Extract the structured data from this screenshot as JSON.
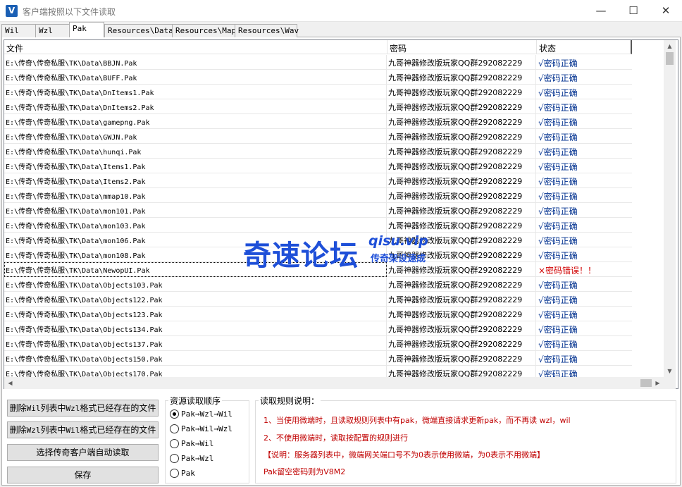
{
  "window": {
    "app_icon": "V",
    "title": "客户端按照以下文件读取",
    "minimize": "—",
    "maximize": "☐",
    "close": "✕"
  },
  "tabs": [
    {
      "label": "Wil",
      "active": false
    },
    {
      "label": "Wzl",
      "active": false
    },
    {
      "label": "Pak",
      "active": true
    },
    {
      "label": "Resources\\Data",
      "active": false
    },
    {
      "label": "Resources\\Map",
      "active": false
    },
    {
      "label": "Resources\\Wav",
      "active": false
    }
  ],
  "list": {
    "columns": [
      "文件",
      "密码",
      "状态"
    ],
    "rows": [
      {
        "file": "E:\\传奇\\传奇私服\\TK\\Data\\BBJN.Pak",
        "password": "九哥神器修改版玩家QQ群292082229",
        "status": "√密码正确",
        "ok": true
      },
      {
        "file": "E:\\传奇\\传奇私服\\TK\\Data\\BUFF.Pak",
        "password": "九哥神器修改版玩家QQ群292082229",
        "status": "√密码正确",
        "ok": true
      },
      {
        "file": "E:\\传奇\\传奇私服\\TK\\Data\\DnItems1.Pak",
        "password": "九哥神器修改版玩家QQ群292082229",
        "status": "√密码正确",
        "ok": true
      },
      {
        "file": "E:\\传奇\\传奇私服\\TK\\Data\\DnItems2.Pak",
        "password": "九哥神器修改版玩家QQ群292082229",
        "status": "√密码正确",
        "ok": true
      },
      {
        "file": "E:\\传奇\\传奇私服\\TK\\Data\\gamepng.Pak",
        "password": "九哥神器修改版玩家QQ群292082229",
        "status": "√密码正确",
        "ok": true
      },
      {
        "file": "E:\\传奇\\传奇私服\\TK\\Data\\GWJN.Pak",
        "password": "九哥神器修改版玩家QQ群292082229",
        "status": "√密码正确",
        "ok": true
      },
      {
        "file": "E:\\传奇\\传奇私服\\TK\\Data\\hunqi.Pak",
        "password": "九哥神器修改版玩家QQ群292082229",
        "status": "√密码正确",
        "ok": true
      },
      {
        "file": "E:\\传奇\\传奇私服\\TK\\Data\\Items1.Pak",
        "password": "九哥神器修改版玩家QQ群292082229",
        "status": "√密码正确",
        "ok": true
      },
      {
        "file": "E:\\传奇\\传奇私服\\TK\\Data\\Items2.Pak",
        "password": "九哥神器修改版玩家QQ群292082229",
        "status": "√密码正确",
        "ok": true
      },
      {
        "file": "E:\\传奇\\传奇私服\\TK\\Data\\mmap10.Pak",
        "password": "九哥神器修改版玩家QQ群292082229",
        "status": "√密码正确",
        "ok": true
      },
      {
        "file": "E:\\传奇\\传奇私服\\TK\\Data\\mon101.Pak",
        "password": "九哥神器修改版玩家QQ群292082229",
        "status": "√密码正确",
        "ok": true
      },
      {
        "file": "E:\\传奇\\传奇私服\\TK\\Data\\mon103.Pak",
        "password": "九哥神器修改版玩家QQ群292082229",
        "status": "√密码正确",
        "ok": true
      },
      {
        "file": "E:\\传奇\\传奇私服\\TK\\Data\\mon106.Pak",
        "password": "九哥神器修改版玩家QQ群292082229",
        "status": "√密码正确",
        "ok": true
      },
      {
        "file": "E:\\传奇\\传奇私服\\TK\\Data\\mon108.Pak",
        "password": "九哥神器修改版玩家QQ群292082229",
        "status": "√密码正确",
        "ok": true
      },
      {
        "file": "E:\\传奇\\传奇私服\\TK\\Data\\NewopUI.Pak",
        "password": "九哥神器修改版玩家QQ群292082229",
        "status": "×密码错误！！",
        "ok": false,
        "selected": true
      },
      {
        "file": "E:\\传奇\\传奇私服\\TK\\Data\\Objects103.Pak",
        "password": "九哥神器修改版玩家QQ群292082229",
        "status": "√密码正确",
        "ok": true
      },
      {
        "file": "E:\\传奇\\传奇私服\\TK\\Data\\Objects122.Pak",
        "password": "九哥神器修改版玩家QQ群292082229",
        "status": "√密码正确",
        "ok": true
      },
      {
        "file": "E:\\传奇\\传奇私服\\TK\\Data\\Objects123.Pak",
        "password": "九哥神器修改版玩家QQ群292082229",
        "status": "√密码正确",
        "ok": true
      },
      {
        "file": "E:\\传奇\\传奇私服\\TK\\Data\\Objects134.Pak",
        "password": "九哥神器修改版玩家QQ群292082229",
        "status": "√密码正确",
        "ok": true
      },
      {
        "file": "E:\\传奇\\传奇私服\\TK\\Data\\Objects137.Pak",
        "password": "九哥神器修改版玩家QQ群292082229",
        "status": "√密码正确",
        "ok": true
      },
      {
        "file": "E:\\传奇\\传奇私服\\TK\\Data\\Objects150.Pak",
        "password": "九哥神器修改版玩家QQ群292082229",
        "status": "√密码正确",
        "ok": true
      },
      {
        "file": "E:\\传奇\\传奇私服\\TK\\Data\\Objects170.Pak",
        "password": "九哥神器修改版玩家QQ群292082229",
        "status": "√密码正确",
        "ok": true
      }
    ],
    "scroll_up": "▲",
    "scroll_down": "▼",
    "scroll_left": "◀",
    "scroll_right": "▶"
  },
  "colors": {
    "ok_status": "#00308f",
    "error_status": "#d00000",
    "rules_text": "#c00000",
    "watermark": "#1e4fd8"
  },
  "buttons": {
    "delete_wil_prefix": "删除",
    "delete_wil_mono1": "Wil",
    "delete_wil_mid": "列表中",
    "delete_wil_mono2": "Wzl",
    "delete_wil_suffix": "格式已经存在的文件",
    "delete_wzl_prefix": "删除",
    "delete_wzl_mono1": "Wzl",
    "delete_wzl_mid": "列表中",
    "delete_wzl_mono2": "Wil",
    "delete_wzl_suffix": "格式已经存在的文件",
    "auto_read": "选择传奇客户端自动读取",
    "save": "保存"
  },
  "order_group": {
    "title": "资源读取顺序",
    "options": [
      {
        "label": "Pak→Wzl→Wil",
        "checked": true
      },
      {
        "label": "Pak→Wil→Wzl",
        "checked": false
      },
      {
        "label": "Pak→Wil",
        "checked": false
      },
      {
        "label": "Pak→Wzl",
        "checked": false
      },
      {
        "label": "Pak",
        "checked": false
      }
    ]
  },
  "rules_group": {
    "title": "读取规则说明：",
    "lines": [
      "1、当使用微端时，且读取规则列表中有pak，微端直接请求更新pak，而不再读 wzl，wil",
      "2、不使用微端时，读取按配置的规则进行",
      "【说明：服务器列表中，微端网关端口号不为0表示使用微端，为0表示不用微端】",
      "Pak留空密码则为V8M2"
    ]
  },
  "watermark": {
    "main": "奇速论坛",
    "url": "qisu.vip",
    "sub": "传奇架设速成"
  }
}
